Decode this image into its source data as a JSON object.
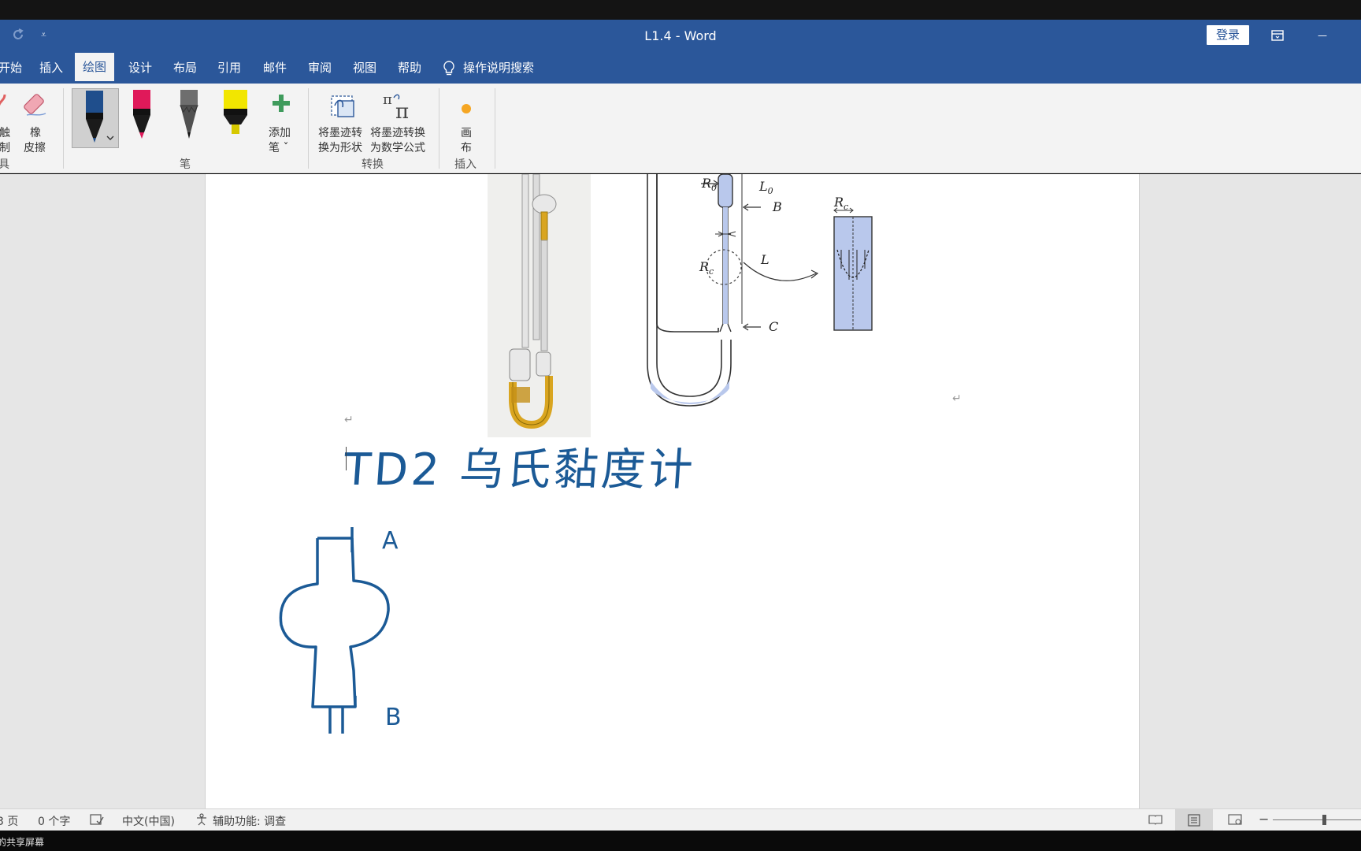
{
  "window": {
    "title": "L1.4  -  Word",
    "signin_label": "登录",
    "minimize_glyph": "—",
    "restore_glyph": "⧉"
  },
  "quick_access": {
    "redo_icon": "redo-icon",
    "customize_glyph": "⩡"
  },
  "tabs": [
    {
      "label": "开始"
    },
    {
      "label": "插入"
    },
    {
      "label": "绘图"
    },
    {
      "label": "设计"
    },
    {
      "label": "布局"
    },
    {
      "label": "引用"
    },
    {
      "label": "邮件"
    },
    {
      "label": "审阅"
    },
    {
      "label": "视图"
    },
    {
      "label": "帮助"
    }
  ],
  "active_tab": "绘图",
  "tell_me": "操作说明搜索",
  "ribbon": {
    "tools": {
      "touch_label_1": "触",
      "touch_label_2": "制",
      "eraser_label_1": "橡",
      "eraser_label_2": "皮擦",
      "group_label": "具"
    },
    "pens": {
      "group_label": "笔",
      "add_pen_label_1": "添加",
      "add_pen_label_2": "笔 ˇ",
      "pen_colors": [
        "#1f4e8c",
        "#e0195a",
        "#5a5a5a",
        "#f2e600"
      ]
    },
    "convert": {
      "group_label": "转换",
      "to_shape_1": "将墨迹转",
      "to_shape_2": "换为形状",
      "to_math_1": "将墨迹转换",
      "to_math_2": "为数学公式"
    },
    "insert": {
      "group_label": "插入",
      "canvas_1": "画",
      "canvas_2": "布"
    }
  },
  "document": {
    "diagram_labels": {
      "r0": "R",
      "r0_sub": "0",
      "l0": "L",
      "l0_sub": "0",
      "b": "B",
      "rc": "R",
      "rc_sub": "c",
      "l": "L",
      "c": "C",
      "rc2": "R",
      "rc2_sub": "c"
    },
    "handwriting": "TD2 乌氏黏度计",
    "sketch_labels": {
      "a": "A",
      "b": "B"
    },
    "paragraph_mark": "↵"
  },
  "status": {
    "page": "3 页",
    "words": "0 个字",
    "language": "中文(中国)",
    "accessibility": "辅助功能: 调查"
  },
  "taskbar_text": "的共享屏幕"
}
